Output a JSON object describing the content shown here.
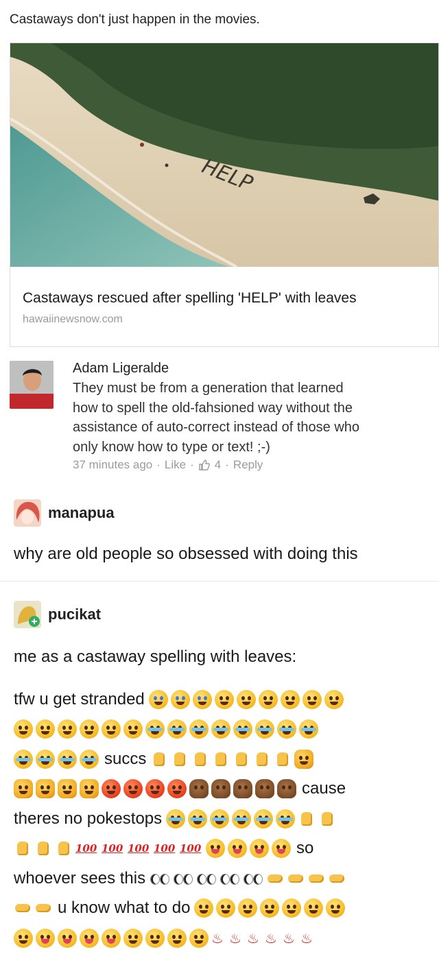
{
  "headline": "Castaways don't just happen in the movies.",
  "link_card": {
    "title": "Castaways rescued after spelling 'HELP' with leaves",
    "source": "hawaiinewsnow.com",
    "photo_text": "HELP"
  },
  "comment": {
    "author": "Adam Ligeralde",
    "lines": [
      "They must be from a generation that learned",
      "how to spell the old-fahsioned way without the",
      "assistance of auto-correct instead of those who",
      "only know how to type or text! ;-)"
    ],
    "time": "37 minutes ago",
    "like": "Like",
    "likes": "4",
    "reply": "Reply",
    "sep": "·"
  },
  "post1": {
    "username": "manapua",
    "text": "why are old people so obsessed with doing this"
  },
  "post2": {
    "username": "pucikat",
    "caption": "me as a castaway spelling with leaves:",
    "w_tfw": "tfw u get stranded",
    "w_succs": "succs",
    "w_cause": "cause",
    "w_theres": "theres no pokestops",
    "w_so": "so",
    "w_whoever": "whoever sees this",
    "w_know": "u know what to do",
    "hundred": "100"
  },
  "colors": {
    "background": "#ffffff",
    "meta_gray": "#9b9b9b",
    "divider": "#e8e8e8"
  }
}
